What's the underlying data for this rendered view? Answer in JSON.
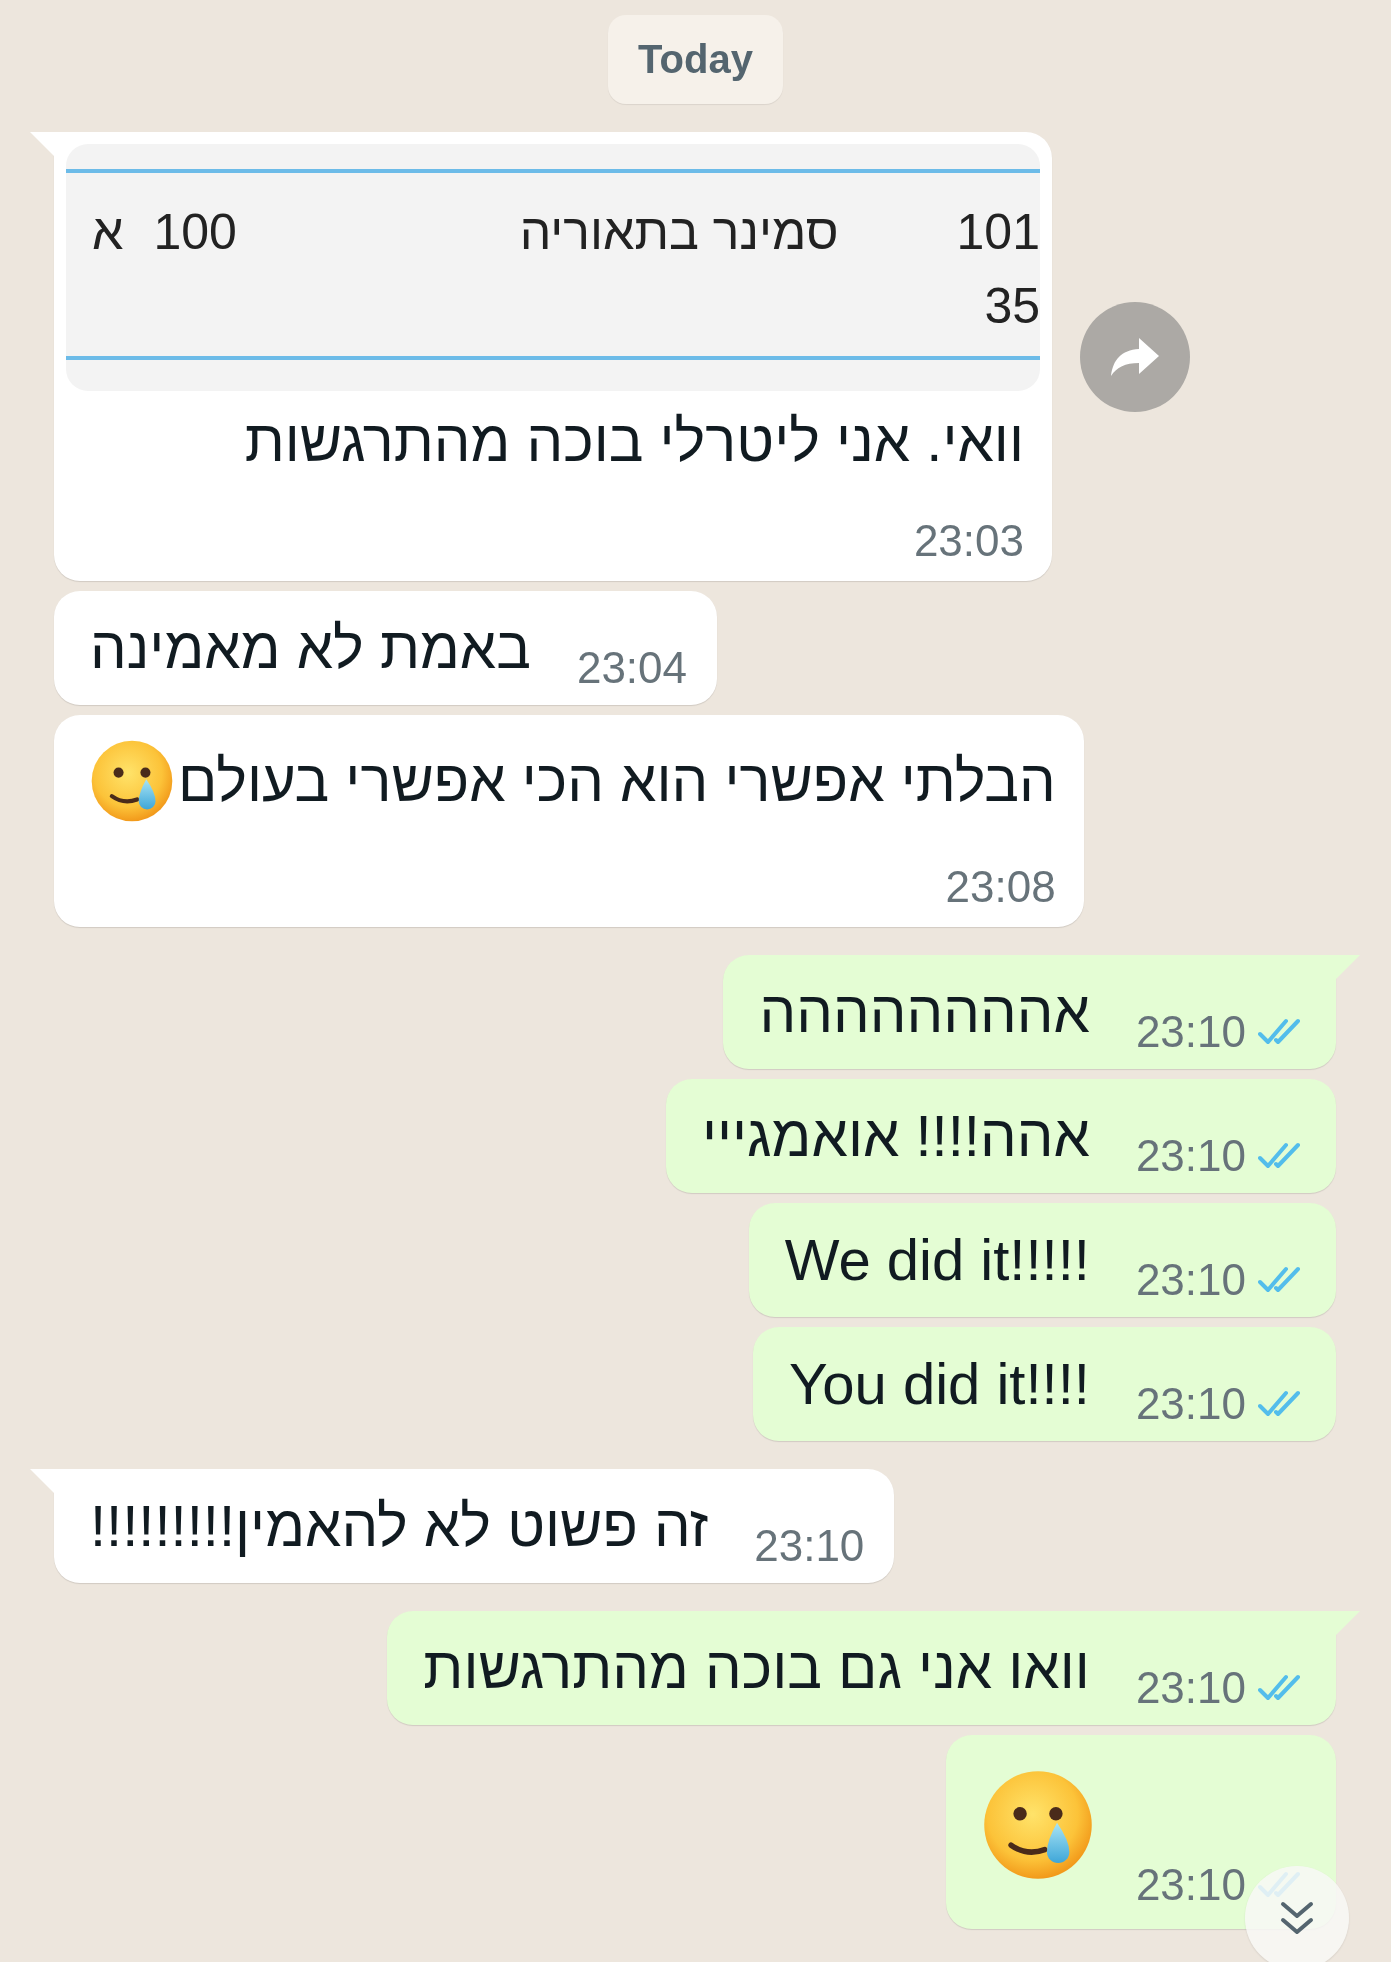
{
  "date_chip": "Today",
  "messages": [
    {
      "kind": "text",
      "outgoing": false,
      "tail": true,
      "forward_button": true,
      "attachment": {
        "rows": [
          [
            "101",
            "סמינר בתאוריה",
            "100",
            "א"
          ],
          [
            "35"
          ]
        ]
      },
      "text": "וואי. אני ליטרלי בוכה מהתרגשות",
      "emoji": false,
      "time_below": true,
      "time": "23:03"
    },
    {
      "kind": "text",
      "outgoing": false,
      "tail": false,
      "text": "באמת לא מאמינה",
      "emoji": false,
      "time_below": false,
      "time": "23:04"
    },
    {
      "kind": "text",
      "outgoing": false,
      "tail": false,
      "text": "הבלתי אפשרי הוא הכי אפשרי בעולם",
      "emoji": true,
      "time_below": true,
      "time": "23:08"
    },
    {
      "kind": "text",
      "outgoing": true,
      "tail": true,
      "text": "אהההההההה",
      "emoji": false,
      "time_below": false,
      "time": "23:10",
      "read": true
    },
    {
      "kind": "text",
      "outgoing": true,
      "tail": false,
      "text": "אהה!!!! אואמגייי",
      "emoji": false,
      "time_below": false,
      "time": "23:10",
      "read": true
    },
    {
      "kind": "text",
      "outgoing": true,
      "tail": false,
      "text": "We did it!!!!!",
      "emoji": false,
      "time_below": false,
      "time": "23:10",
      "read": true
    },
    {
      "kind": "text",
      "outgoing": true,
      "tail": false,
      "text": "You did it!!!!",
      "emoji": false,
      "time_below": false,
      "time": "23:10",
      "read": true
    },
    {
      "kind": "text",
      "outgoing": false,
      "tail": true,
      "text": "זה פשוט לא להאמין!!!!!!!!!",
      "emoji": false,
      "time_below": false,
      "time": "23:10"
    },
    {
      "kind": "text",
      "outgoing": true,
      "tail": true,
      "text": "וואו אני גם בוכה מהתרגשות",
      "emoji": false,
      "time_below": false,
      "time": "23:10",
      "read": true
    },
    {
      "kind": "emoji",
      "outgoing": true,
      "tail": false,
      "time": "23:10",
      "read": true
    }
  ],
  "scroll_down_button": true
}
